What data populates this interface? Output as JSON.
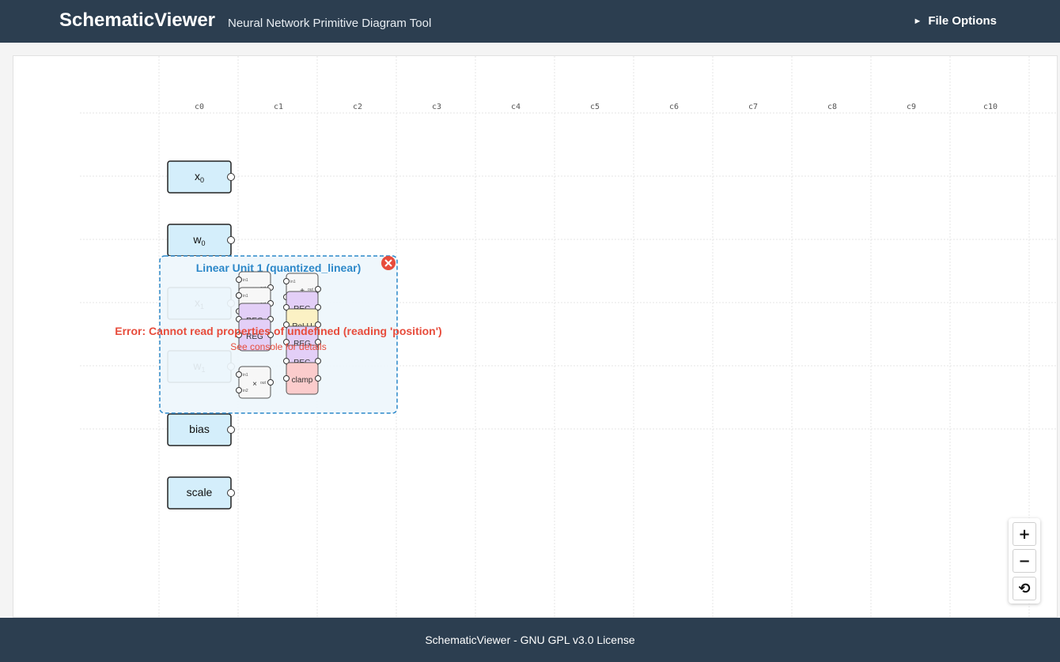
{
  "header": {
    "title": "SchematicViewer",
    "subtitle": "Neural Network Primitive Diagram Tool",
    "file_options_label": "File Options",
    "file_options_icon": "triangle-right-icon"
  },
  "canvas": {
    "columns": [
      "c0",
      "c1",
      "c2",
      "c3",
      "c4",
      "c5",
      "c6",
      "c7",
      "c8",
      "c9",
      "c10"
    ],
    "inputs": [
      {
        "label": "x",
        "sub": "0"
      },
      {
        "label": "w",
        "sub": "0"
      },
      {
        "label": "x",
        "sub": "1"
      },
      {
        "label": "w",
        "sub": "1"
      },
      {
        "label": "bias",
        "sub": ""
      },
      {
        "label": "scale",
        "sub": ""
      }
    ],
    "unit": {
      "title": "Linear Unit 1 (quantized_linear)",
      "close_icon": "close-icon",
      "error_message": "Error: Cannot read properties of undefined (reading 'position')",
      "error_hint": "See console for details",
      "mini_nodes": [
        {
          "label": "×",
          "color": "#f7f7f7",
          "ports": [
            "in1",
            "in2"
          ],
          "out": "out"
        },
        {
          "label": "×",
          "color": "#f7f7f7",
          "ports": [
            "in1",
            "in2"
          ],
          "out": "out"
        },
        {
          "label": "REG",
          "color": "#e3cff7",
          "ports": [],
          "out": ""
        },
        {
          "label": "REG",
          "color": "#e3cff7",
          "ports": [],
          "out": ""
        },
        {
          "label": "+",
          "color": "#f7f7f7",
          "ports": [
            "in1",
            "in2"
          ],
          "out": "out"
        },
        {
          "label": "REG",
          "color": "#e3cff7",
          "ports": [],
          "out": ""
        },
        {
          "label": "ReLU",
          "color": "#fbf1c4",
          "ports": [],
          "out": ""
        },
        {
          "label": "REG",
          "color": "#e3cff7",
          "ports": [],
          "out": ""
        },
        {
          "label": "REG",
          "color": "#e3cff7",
          "ports": [],
          "out": ""
        },
        {
          "label": "×",
          "color": "#f7f7f7",
          "ports": [
            "in1",
            "in2"
          ],
          "out": "out"
        },
        {
          "label": "clamp",
          "color": "#fbcccc",
          "ports": [],
          "out": ""
        }
      ]
    },
    "colors": {
      "input_fill": "#d4eefb",
      "unit_border": "#2c88c9",
      "unit_fill": "#eef6fc",
      "error_red": "#e74c3c",
      "grid": "#e6e6e6"
    }
  },
  "zoom": {
    "zoom_in_label": "+",
    "zoom_out_label": "−",
    "reset_label": "⟲"
  },
  "footer": {
    "text": "SchematicViewer - GNU GPL v3.0 License"
  }
}
